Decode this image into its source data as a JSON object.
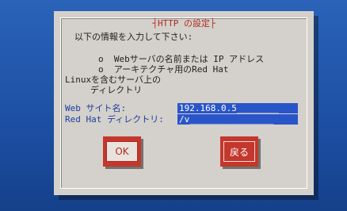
{
  "dialog": {
    "title": "HTTP の設定",
    "prompt": "以下の情報を入力して下さい:",
    "bullet1": "o  Webサーバの名前または IP アドレス",
    "bullet2": "o  アーキテクチャ用のRed Hat",
    "bullet2_cont1": "Linuxを含むサーバ上の",
    "bullet2_cont2": "ディレクトリ"
  },
  "form": {
    "web_site_label": "Web サイト名:",
    "web_site_value": "192.168.0.5________",
    "redhat_dir_label": "Red Hat ディレクトリ:",
    "redhat_dir_value": "/v________________"
  },
  "buttons": {
    "ok_label": "OK",
    "back_label": "戻る"
  },
  "colors": {
    "background": "#1e55ad",
    "dialog": "#d4d0cb",
    "accent": "#c3372c",
    "field": "#2a55c8"
  }
}
